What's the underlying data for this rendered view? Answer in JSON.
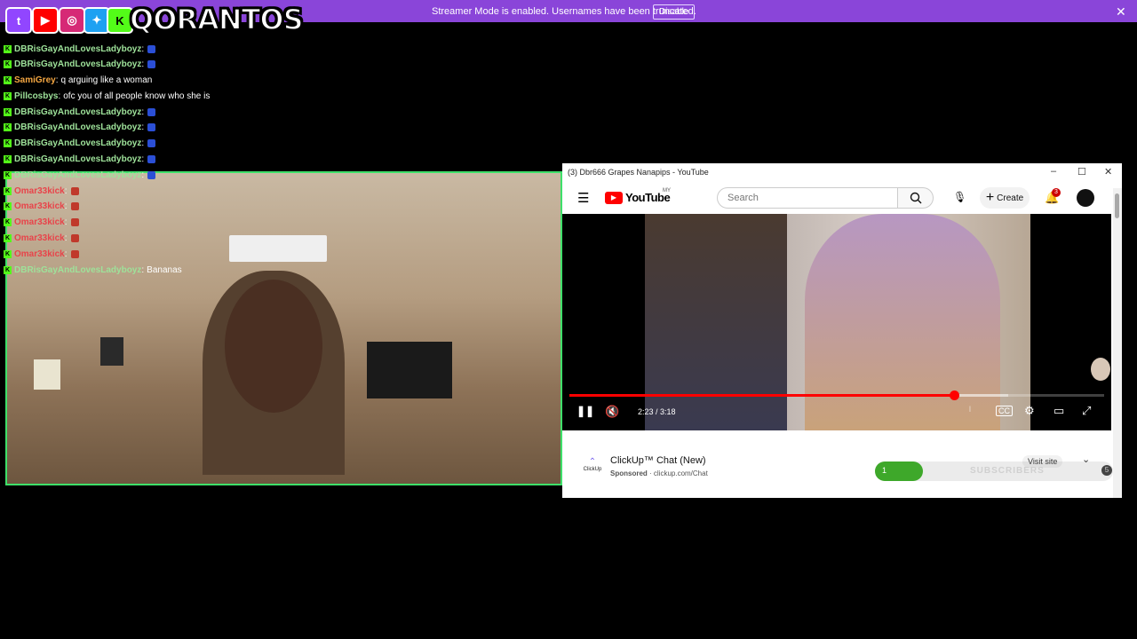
{
  "banner": {
    "message": "Streamer Mode is enabled. Usernames have been truncated.",
    "disable_label": "Disable"
  },
  "logo": {
    "name": "QORANTOS",
    "socials": [
      "twitch-icon",
      "youtube-icon",
      "instagram-icon",
      "twitter-icon",
      "kick-icon"
    ]
  },
  "chat": [
    {
      "user": "DBRisGayAndLovesLadyboyz",
      "sep": ":",
      "text": "",
      "color": "#9ee29a"
    },
    {
      "user": "DBRisGayAndLovesLadyboyz",
      "sep": ":",
      "text": "",
      "color": "#9ee29a"
    },
    {
      "user": "SamiGrey",
      "sep": ":",
      "text": "q arguing like a woman",
      "color": "#f5a742"
    },
    {
      "user": "Pillcosbys",
      "sep": ":",
      "text": "ofc you of all people know who she is",
      "color": "#9ee29a"
    },
    {
      "user": "DBRisGayAndLovesLadyboyz",
      "sep": ":",
      "text": "",
      "color": "#9ee29a"
    },
    {
      "user": "DBRisGayAndLovesLadyboyz",
      "sep": ":",
      "text": "",
      "color": "#9ee29a"
    },
    {
      "user": "DBRisGayAndLovesLadyboyz",
      "sep": ":",
      "text": "",
      "color": "#9ee29a"
    },
    {
      "user": "DBRisGayAndLovesLadyboyz",
      "sep": ":",
      "text": "",
      "color": "#9ee29a"
    },
    {
      "user": "DBRisGayAndLovesLadyboyz",
      "sep": ":",
      "text": "",
      "color": "#9ee29a"
    },
    {
      "user": "Omar33kick",
      "sep": ":",
      "text": "",
      "color": "#e8434a"
    },
    {
      "user": "Omar33kick",
      "sep": ":",
      "text": "",
      "color": "#e8434a"
    },
    {
      "user": "Omar33kick",
      "sep": ":",
      "text": "",
      "color": "#e8434a"
    },
    {
      "user": "Omar33kick",
      "sep": ":",
      "text": "",
      "color": "#e8434a"
    },
    {
      "user": "Omar33kick",
      "sep": ":",
      "text": "",
      "color": "#e8434a"
    },
    {
      "user": "DBRisGayAndLovesLadyboyz",
      "sep": ":",
      "text": "Bananas",
      "color": "#9ee29a"
    }
  ],
  "youtube": {
    "window_title": "(3) Dbr666 Grapes Nanapips - YouTube",
    "logo_text": "YouTube",
    "region": "MY",
    "search_placeholder": "Search",
    "create_label": "Create",
    "notification_count": "3",
    "player": {
      "time": "2:23 / 3:18",
      "progress": 0.72,
      "buffered": 0.82
    },
    "ad": {
      "title": "ClickUp™ Chat (New)",
      "sponsored": "Sponsored",
      "domain": "clickup.com/Chat",
      "brand": "ClickUp",
      "visit_label": "Visit site"
    }
  },
  "subscribers": {
    "count": "1",
    "label": "SUBSCRIBERS",
    "goal": "5",
    "fill": 0.2
  }
}
